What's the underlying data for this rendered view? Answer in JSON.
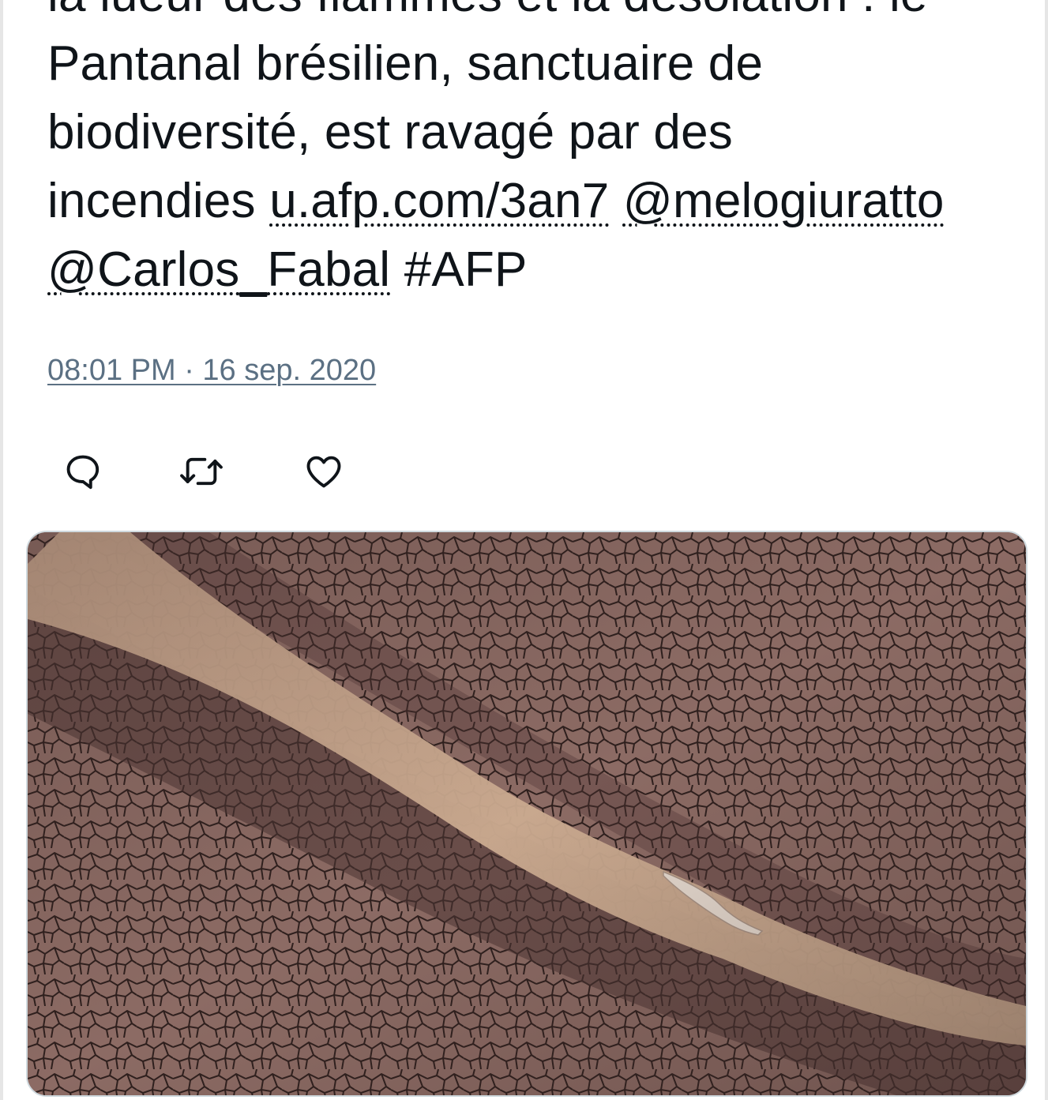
{
  "tweet": {
    "text_lines": [
      "la lueur des flammes et la désolation : le",
      "Pantanal brésilien, sanctuaire de",
      "biodiversité, est ravagé par des"
    ],
    "last_line_prefix": "incendies ",
    "link_url": "u.afp.com/3an7",
    "mention_1": "@melogiuratto",
    "mention_2_part1": "@Carlos",
    "mention_2_part2": "_",
    "mention_2_part3": "Fabal",
    "hashtag": " #AFP",
    "timestamp": "08:01 PM · 16 sep. 2020"
  },
  "actions": {
    "reply_icon": "reply-icon",
    "retweet_icon": "retweet-icon",
    "like_icon": "heart-icon"
  },
  "media": {
    "description_icon": "photo",
    "colors": {
      "mud": "#8c6b64",
      "dark_mud": "#5a4240",
      "river": "#c7a58a",
      "crack": "#2e1f1d"
    }
  },
  "colors": {
    "text": "#0f1419",
    "secondary": "#5b7083",
    "border": "#cfd9de"
  }
}
